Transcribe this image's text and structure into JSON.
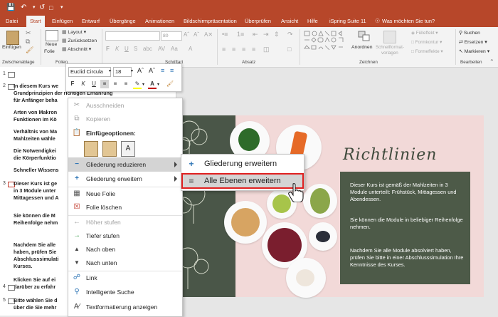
{
  "title_bar": {
    "quick_access": [
      "save-icon",
      "undo-icon",
      "redo-icon",
      "start-from-beginning-icon"
    ]
  },
  "tabs": [
    "Datei",
    "Start",
    "Einfügen",
    "Entwurf",
    "Übergänge",
    "Animationen",
    "Bildschirmpräsentation",
    "Überprüfen",
    "Ansicht",
    "Hilfe",
    "iSpring Suite 11",
    "Was möchten Sie tun?"
  ],
  "active_tab": "Start",
  "ribbon": {
    "groups": [
      "Zwischenablage",
      "Folien",
      "Schriftart",
      "Absatz",
      "Zeichnen",
      "Bearbeiten"
    ],
    "paste_label": "Einfügen",
    "new_slide_label_1": "Neue",
    "new_slide_label_2": "Folie",
    "layout_label": "Layout",
    "reset_label": "Zurücksetzen",
    "section_label": "Abschnitt",
    "font_size": "80",
    "arrange_label": "Anordnen",
    "quick_styles_label_1": "Schnellformat-",
    "quick_styles_label_2": "vorlagen",
    "shape_fill_label": "Fülleffekt",
    "shape_outline_label": "Formkontur",
    "shape_effects_label": "Formeffekte",
    "find_label": "Suchen",
    "replace_label": "Ersetzen",
    "select_label": "Markieren"
  },
  "mini_toolbar": {
    "font_name": "Euclid Circula",
    "font_size": "18",
    "bold": "F",
    "italic": "K",
    "underline": "U",
    "accent_color": "#c00000",
    "highlight_color": "#ffff00"
  },
  "outline": {
    "slides": [
      {
        "num": "1",
        "lines": []
      },
      {
        "num": "2",
        "lines": [
          "In diesem Kurs we",
          "Grundprinzipien der richtigen Ernährung",
          "für Anfänger beha",
          "Arten von Makron",
          "Funktionen im Kö",
          "Verhältnis von Ma",
          "Mahlzeiten wähle",
          "Die Notwendigkei",
          "die Körperfunktio",
          "Schneller Wissens"
        ]
      },
      {
        "num": "3",
        "lines": [
          "Dieser Kurs ist ge",
          "in 3 Module unter",
          "Mittagessen und A",
          "Sie können die M",
          "Reihenfolge nehm",
          "Nachdem Sie alle",
          "haben, prüfen Sie",
          "Abschlusssimulati",
          "Kurses.",
          "Klicken Sie auf ei",
          "darüber zu erfahr"
        ]
      },
      {
        "num": "4",
        "lines": []
      },
      {
        "num": "5",
        "lines": [
          "Bitte wählen Sie d",
          "über die Sie mehr"
        ]
      }
    ]
  },
  "context_menu": {
    "items": [
      {
        "label": "Ausschneiden",
        "disabled": true,
        "icon": "scissors-icon"
      },
      {
        "label": "Kopieren",
        "disabled": true,
        "icon": "copy-icon"
      },
      {
        "label": "Einfügeoptionen:",
        "disabled": false,
        "icon": "clipboard-icon",
        "header": true
      },
      {
        "label": "Gliederung reduzieren",
        "disabled": false,
        "icon": "minus-icon",
        "submenu": true
      },
      {
        "label": "Gliederung erweitern",
        "disabled": false,
        "icon": "plus-icon",
        "submenu": true
      },
      {
        "label": "Neue Folie",
        "disabled": false,
        "icon": "new-slide-icon"
      },
      {
        "label": "Folie löschen",
        "disabled": false,
        "icon": "delete-slide-icon"
      },
      {
        "label": "Höher stufen",
        "disabled": true,
        "icon": "promote-icon"
      },
      {
        "label": "Tiefer stufen",
        "disabled": false,
        "icon": "demote-icon"
      },
      {
        "label": "Nach oben",
        "disabled": false,
        "icon": "move-up-icon"
      },
      {
        "label": "Nach unten",
        "disabled": false,
        "icon": "move-down-icon"
      },
      {
        "label": "Link",
        "disabled": false,
        "icon": "link-icon"
      },
      {
        "label": "Intelligente Suche",
        "disabled": false,
        "icon": "smart-lookup-icon"
      },
      {
        "label": "Textformatierung anzeigen",
        "disabled": false,
        "icon": "show-formatting-icon"
      }
    ]
  },
  "submenu": {
    "items": [
      {
        "label": "Gliederung erweitern",
        "icon": "plus-icon"
      },
      {
        "label": "Alle Ebenen erweitern",
        "icon": "expand-all-icon"
      }
    ]
  },
  "slide": {
    "title": "Richtlinien",
    "box_text": [
      "Dieser Kurs ist gemäß der Mahlzeiten in 3 Module unterteilt: Frühstück, Mittagessen und Abendessen.",
      "Sie können die Module in beliebiger Reihenfolge nehmen.",
      "Nachdem Sie alle Module absolviert haben, prüfen Sie bitte in einer Abschlusssimulation Ihre Kenntnisse des Kurses."
    ],
    "colors": {
      "background": "#f2d9d8",
      "panel": "#4d5a48",
      "accent": "#b7472a",
      "highlight_border": "#e02020"
    }
  }
}
